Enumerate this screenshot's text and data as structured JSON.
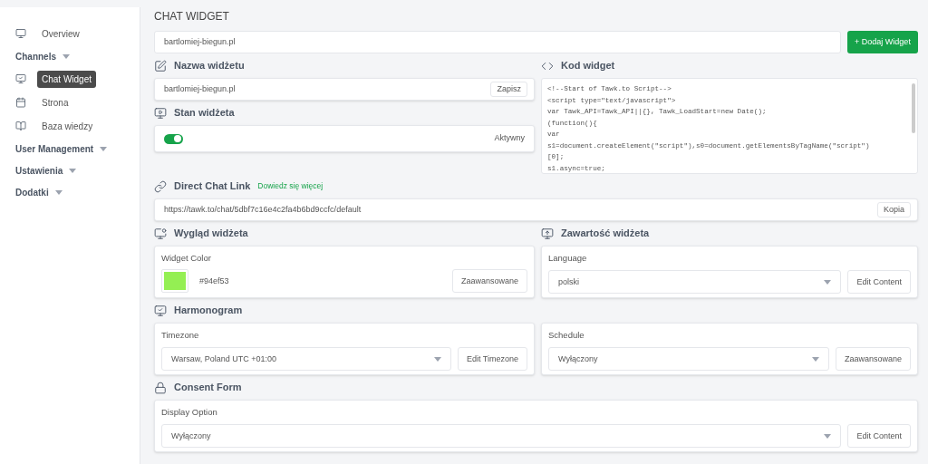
{
  "sidebar": {
    "items": [
      {
        "kind": "link",
        "label": "Overview",
        "selected": false
      },
      {
        "kind": "group",
        "label": "Channels"
      },
      {
        "kind": "link",
        "label": "Chat Widget",
        "selected": true
      },
      {
        "kind": "link",
        "label": "Strona",
        "selected": false
      },
      {
        "kind": "link",
        "label": "Baza wiedzy",
        "selected": false
      },
      {
        "kind": "group",
        "label": "User Management"
      },
      {
        "kind": "group",
        "label": "Ustawienia"
      },
      {
        "kind": "group",
        "label": "Dodatki"
      }
    ]
  },
  "page_title": "CHAT WIDGET",
  "widget_select": {
    "value": "bartlomiej-biegun.pl"
  },
  "add_button": "+ Dodaj Widget",
  "name_section": {
    "title": "Nazwa widżetu",
    "value": "bartlomiej-biegun.pl",
    "button": "Zapisz"
  },
  "status_section": {
    "title": "Stan widżeta",
    "on": true,
    "status": "Aktywny"
  },
  "code_section": {
    "title": "Kod widget",
    "lines": [
      "<!--Start of Tawk.to Script-->",
      "<script type=\"text/javascript\">",
      "var Tawk_API=Tawk_API||{}, Tawk_LoadStart=new Date();",
      "(function(){",
      "var",
      "s1=document.createElement(\"script\"),s0=document.getElementsByTagName(\"script\")",
      "[0];",
      "s1.async=true;"
    ]
  },
  "direct_link": {
    "title": "Direct Chat Link",
    "link": "Dowiedz się więcej",
    "value": "https://tawk.to/chat/5dbf7c16e4c2fa4b6bd9ccfc/default",
    "button": "Kopia"
  },
  "appearance": {
    "title": "Wygląd widżeta",
    "label": "Widget Color",
    "color": "#94ef53",
    "color_code": "#94ef53",
    "button": "Zaawansowane"
  },
  "content": {
    "title": "Zawartość widżeta",
    "label": "Language",
    "value": "polski",
    "button": "Edit Content"
  },
  "schedule_section": {
    "title": "Harmonogram"
  },
  "timezone": {
    "label": "Timezone",
    "value": "Warsaw, Poland UTC +01:00",
    "button": "Edit Timezone"
  },
  "schedule": {
    "label": "Schedule",
    "value": "Wyłączony",
    "button": "Zaawansowane"
  },
  "consent": {
    "title": "Consent Form",
    "label": "Display Option",
    "value": "Wyłączony",
    "button": "Edit Content"
  }
}
